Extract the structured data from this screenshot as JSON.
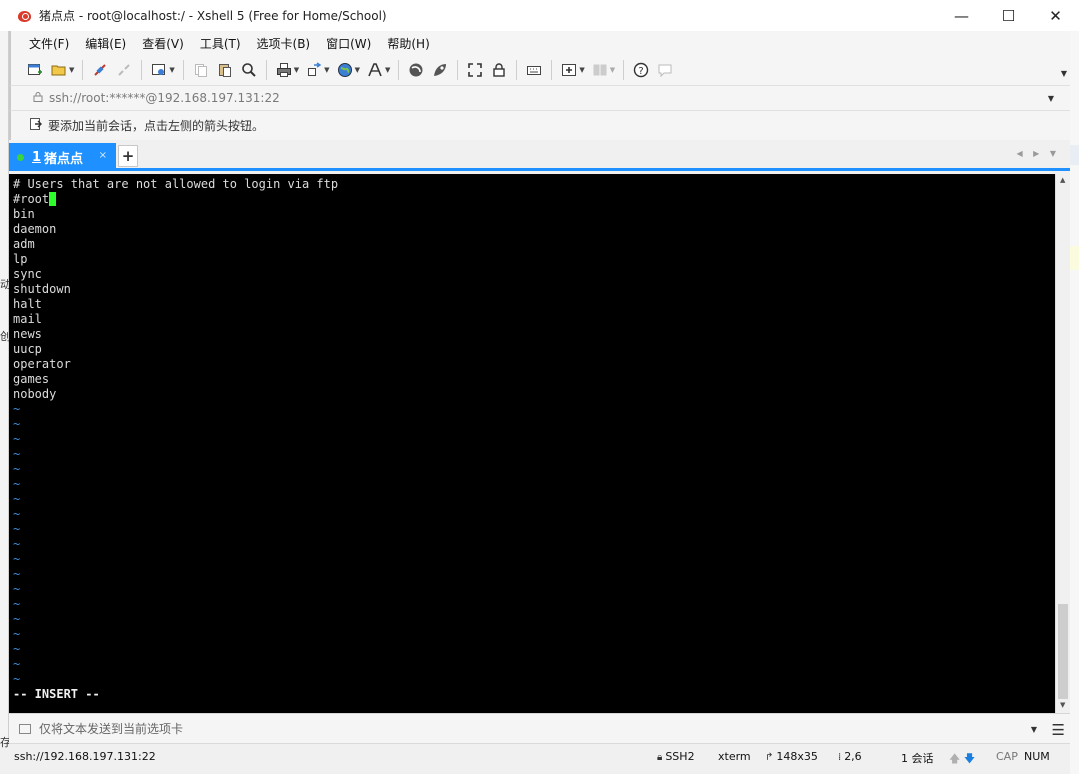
{
  "window": {
    "title": "猪点点 - root@localhost:/ - Xshell 5 (Free for Home/School)",
    "minimize_glyph": "—",
    "maximize_glyph": "☐",
    "close_glyph": "✕"
  },
  "menubar": {
    "items": [
      "文件(F)",
      "编辑(E)",
      "查看(V)",
      "工具(T)",
      "选项卡(B)",
      "窗口(W)",
      "帮助(H)"
    ]
  },
  "toolbar": {
    "icons": [
      "new-session-icon",
      "open-folder-icon",
      "connect-icon",
      "disconnect-icon",
      "properties-icon",
      "copy-icon",
      "paste-icon",
      "find-icon",
      "print-icon",
      "transfer-icon",
      "globe-icon",
      "font-icon",
      "xftp-icon",
      "xmanager-icon",
      "fullscreen-icon",
      "lock-icon",
      "keyboard-icon",
      "new-tab-icon",
      "layout-icon",
      "help-icon",
      "chat-icon"
    ]
  },
  "address": {
    "url": "ssh://root:******@192.168.197.131:22"
  },
  "hint": {
    "text": "要添加当前会话，点击左侧的箭头按钮。"
  },
  "tabs": {
    "active": {
      "number": "1",
      "label": "猪点点"
    },
    "add_label": "+",
    "close_glyph": "×",
    "nav_glyphs": "◀ ▶ ▼"
  },
  "terminal": {
    "lines": [
      "# Users that are not allowed to login via ftp",
      "#root",
      "bin",
      "daemon",
      "adm",
      "lp",
      "sync",
      "shutdown",
      "halt",
      "mail",
      "news",
      "uucp",
      "operator",
      "games",
      "nobody"
    ],
    "tilde": "~",
    "tilde_count": 19,
    "mode_line": "-- INSERT --"
  },
  "compose": {
    "placeholder": "仅将文本发送到当前选项卡"
  },
  "statusbar": {
    "connection": "ssh://192.168.197.131:22",
    "protocol": "SSH2",
    "term_type": "xterm",
    "size": "148x35",
    "cursor_pos": "2,6",
    "sessions": "1 会话",
    "caps": "CAP",
    "num": "NUM"
  },
  "colors": {
    "tab_active": "#1e90ff",
    "cursor": "#2cff2c",
    "tilde": "#3a8edb",
    "terminal_bg": "#000000"
  },
  "left_edge": {
    "a": "动",
    "b": "创",
    "c": "存"
  }
}
